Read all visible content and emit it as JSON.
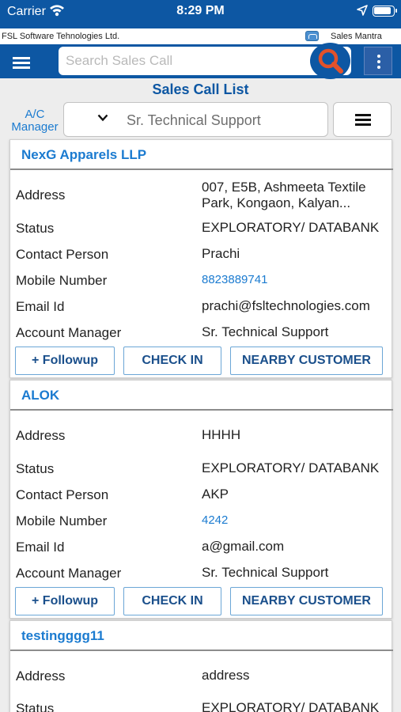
{
  "status_bar": {
    "carrier": "Carrier",
    "time": "8:29 PM"
  },
  "company_bar": {
    "company": "FSL Software Tehnologies Ltd.",
    "app_name": "Sales Mantra"
  },
  "toolbar": {
    "search_placeholder": "Search Sales Call"
  },
  "page_title": "Sales Call List",
  "filter": {
    "label": "A/C Manager",
    "selected": "Sr. Technical Support"
  },
  "labels": {
    "address": "Address",
    "status": "Status",
    "contact": "Contact Person",
    "mobile": "Mobile Number",
    "email": "Email Id",
    "manager": "Account Manager"
  },
  "buttons": {
    "followup": "+ Followup",
    "checkin": "CHECK IN",
    "nearby": "NEARBY CUSTOMER"
  },
  "cards": [
    {
      "name": "NexG Apparels LLP",
      "address": "007, E5B, Ashmeeta Textile Park, Kongaon, Kalyan...",
      "status": "EXPLORATORY/ DATABANK",
      "contact": "Prachi",
      "mobile": "8823889741",
      "email": "prachi@fsltechnologies.com",
      "manager": "Sr. Technical Support"
    },
    {
      "name": "ALOK",
      "address": "HHHH",
      "status": "EXPLORATORY/ DATABANK",
      "contact": "AKP",
      "mobile": "4242",
      "email": "a@gmail.com",
      "manager": "Sr. Technical Support"
    },
    {
      "name": "testingggg11",
      "address": "address",
      "status": "EXPLORATORY/ DATABANK"
    }
  ],
  "colors": {
    "primary": "#0d57a3",
    "link": "#1b7bd0",
    "search_button": "#e2522b"
  }
}
